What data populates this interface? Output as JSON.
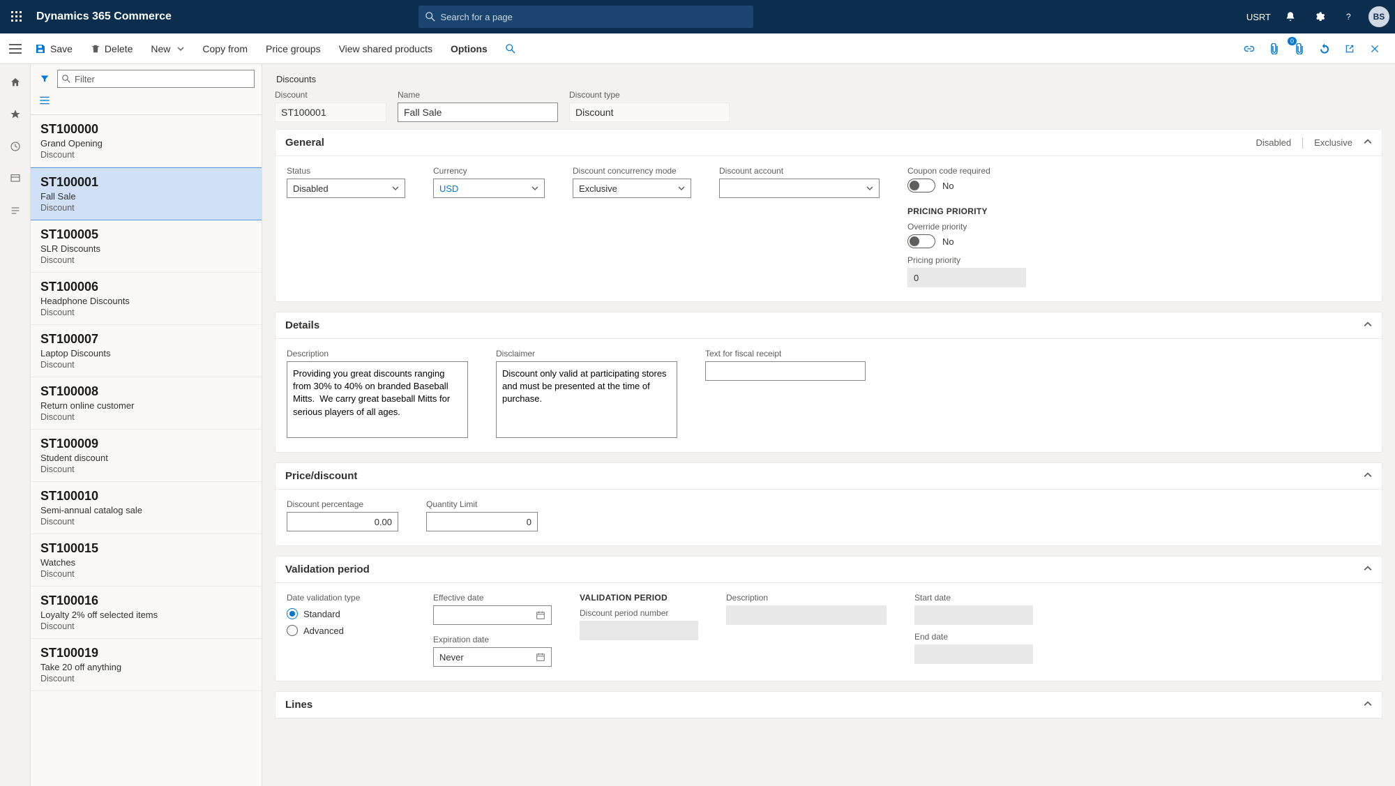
{
  "topnav": {
    "brand": "Dynamics 365 Commerce",
    "search_placeholder": "Search for a page",
    "company": "USRT",
    "avatar": "BS"
  },
  "cmdbar": {
    "save": "Save",
    "delete": "Delete",
    "new": "New",
    "copy_from": "Copy from",
    "price_groups": "Price groups",
    "view_shared": "View shared products",
    "options": "Options",
    "badge": "0"
  },
  "list": {
    "filter_placeholder": "Filter",
    "items": [
      {
        "code": "ST100000",
        "name": "Grand Opening",
        "type": "Discount"
      },
      {
        "code": "ST100001",
        "name": "Fall Sale",
        "type": "Discount"
      },
      {
        "code": "ST100005",
        "name": "SLR Discounts",
        "type": "Discount"
      },
      {
        "code": "ST100006",
        "name": "Headphone Discounts",
        "type": "Discount"
      },
      {
        "code": "ST100007",
        "name": "Laptop Discounts",
        "type": "Discount"
      },
      {
        "code": "ST100008",
        "name": "Return online customer",
        "type": "Discount"
      },
      {
        "code": "ST100009",
        "name": "Student discount",
        "type": "Discount"
      },
      {
        "code": "ST100010",
        "name": "Semi-annual catalog sale",
        "type": "Discount"
      },
      {
        "code": "ST100015",
        "name": "Watches",
        "type": "Discount"
      },
      {
        "code": "ST100016",
        "name": "Loyalty 2% off selected items",
        "type": "Discount"
      },
      {
        "code": "ST100019",
        "name": "Take 20 off anything",
        "type": "Discount"
      }
    ],
    "selected_index": 1
  },
  "detail": {
    "crumb": "Discounts",
    "header": {
      "discount_label": "Discount",
      "discount_value": "ST100001",
      "name_label": "Name",
      "name_value": "Fall Sale",
      "type_label": "Discount type",
      "type_value": "Discount"
    },
    "general": {
      "title": "General",
      "status_label": "Status",
      "status_value": "Disabled",
      "currency_label": "Currency",
      "currency_value": "USD",
      "concurrency_label": "Discount concurrency mode",
      "concurrency_value": "Exclusive",
      "discount_account_label": "Discount account",
      "discount_account_value": "",
      "coupon_label": "Coupon code required",
      "coupon_value": "No",
      "pricing_priority_header": "PRICING PRIORITY",
      "override_label": "Override priority",
      "override_value": "No",
      "priority_label": "Pricing priority",
      "priority_value": "0",
      "summary1": "Disabled",
      "summary2": "Exclusive"
    },
    "details": {
      "title": "Details",
      "description_label": "Description",
      "description_value": "Providing you great discounts ranging from 30% to 40% on branded Baseball Mitts.  We carry great baseball Mitts for serious players of all ages.",
      "disclaimer_label": "Disclaimer",
      "disclaimer_value": "Discount only valid at participating stores and must be presented at the time of purchase.",
      "fiscal_label": "Text for fiscal receipt",
      "fiscal_value": ""
    },
    "price": {
      "title": "Price/discount",
      "pct_label": "Discount percentage",
      "pct_value": "0.00",
      "qty_label": "Quantity Limit",
      "qty_value": "0"
    },
    "validation": {
      "title": "Validation period",
      "type_label": "Date validation type",
      "standard": "Standard",
      "advanced": "Advanced",
      "effective_label": "Effective date",
      "effective_value": "",
      "expiration_label": "Expiration date",
      "expiration_value": "Never",
      "vp_header": "VALIDATION PERIOD",
      "period_number_label": "Discount period number",
      "desc_label": "Description",
      "start_label": "Start date",
      "end_label": "End date"
    },
    "lines": {
      "title": "Lines"
    }
  }
}
